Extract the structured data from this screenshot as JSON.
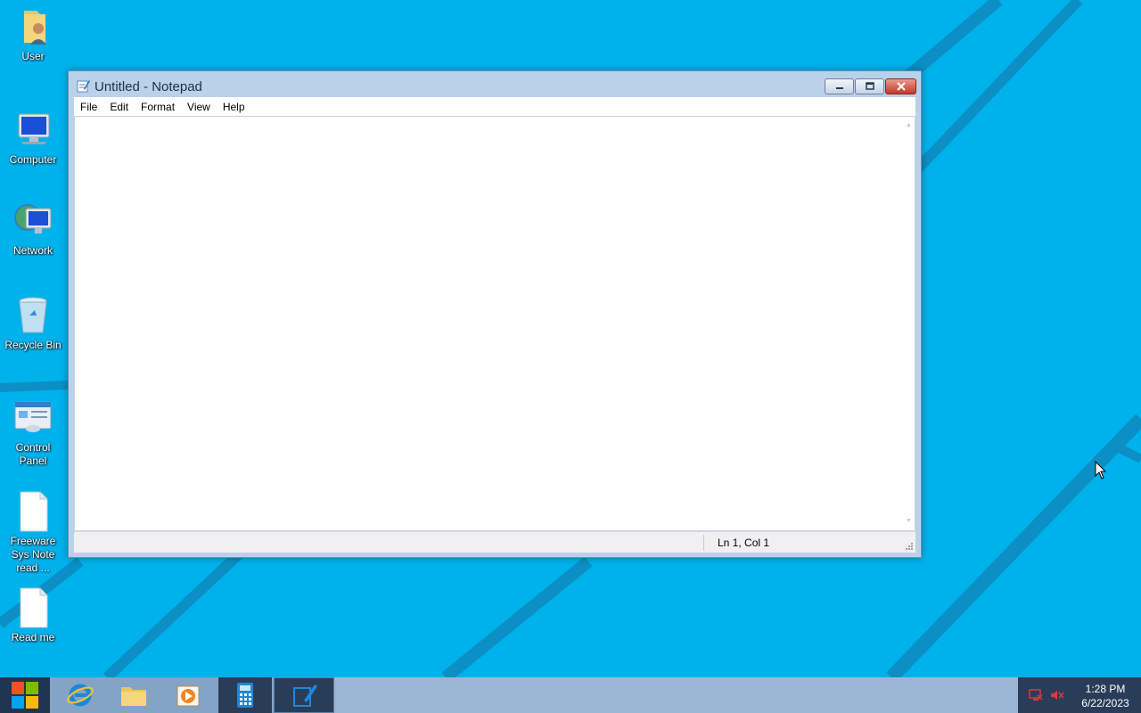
{
  "desktop": {
    "icons": [
      {
        "label": "User",
        "icon": "user-folder-icon"
      },
      {
        "label": "Computer",
        "icon": "computer-icon"
      },
      {
        "label": "Network",
        "icon": "network-icon"
      },
      {
        "label": "Recycle Bin",
        "icon": "recycle-bin-icon"
      },
      {
        "label": "Control Panel",
        "icon": "control-panel-icon"
      },
      {
        "label": "Freeware Sys Note read ...",
        "icon": "text-file-icon"
      },
      {
        "label": "Read me",
        "icon": "text-file-icon"
      }
    ]
  },
  "notepad": {
    "title": "Untitled - Notepad",
    "menu": [
      "File",
      "Edit",
      "Format",
      "View",
      "Help"
    ],
    "content": "",
    "status_position": "Ln 1, Col 1"
  },
  "taskbar": {
    "pinned": [
      {
        "name": "start-button",
        "icon": "windows-logo-icon"
      },
      {
        "name": "internet-explorer",
        "icon": "internet-explorer-icon"
      },
      {
        "name": "file-explorer",
        "icon": "folder-icon"
      },
      {
        "name": "media-player",
        "icon": "media-player-icon"
      },
      {
        "name": "calculator",
        "icon": "calculator-icon"
      },
      {
        "name": "notepad",
        "icon": "notepad-icon",
        "active": true
      }
    ],
    "clock": {
      "time": "1:28 PM",
      "date": "6/22/2023"
    }
  },
  "colors": {
    "desktop_bg": "#00b2ec",
    "taskbar": "#9bb6d3",
    "window_frame": "#b9d1ea",
    "close_button": "#c1392b"
  }
}
